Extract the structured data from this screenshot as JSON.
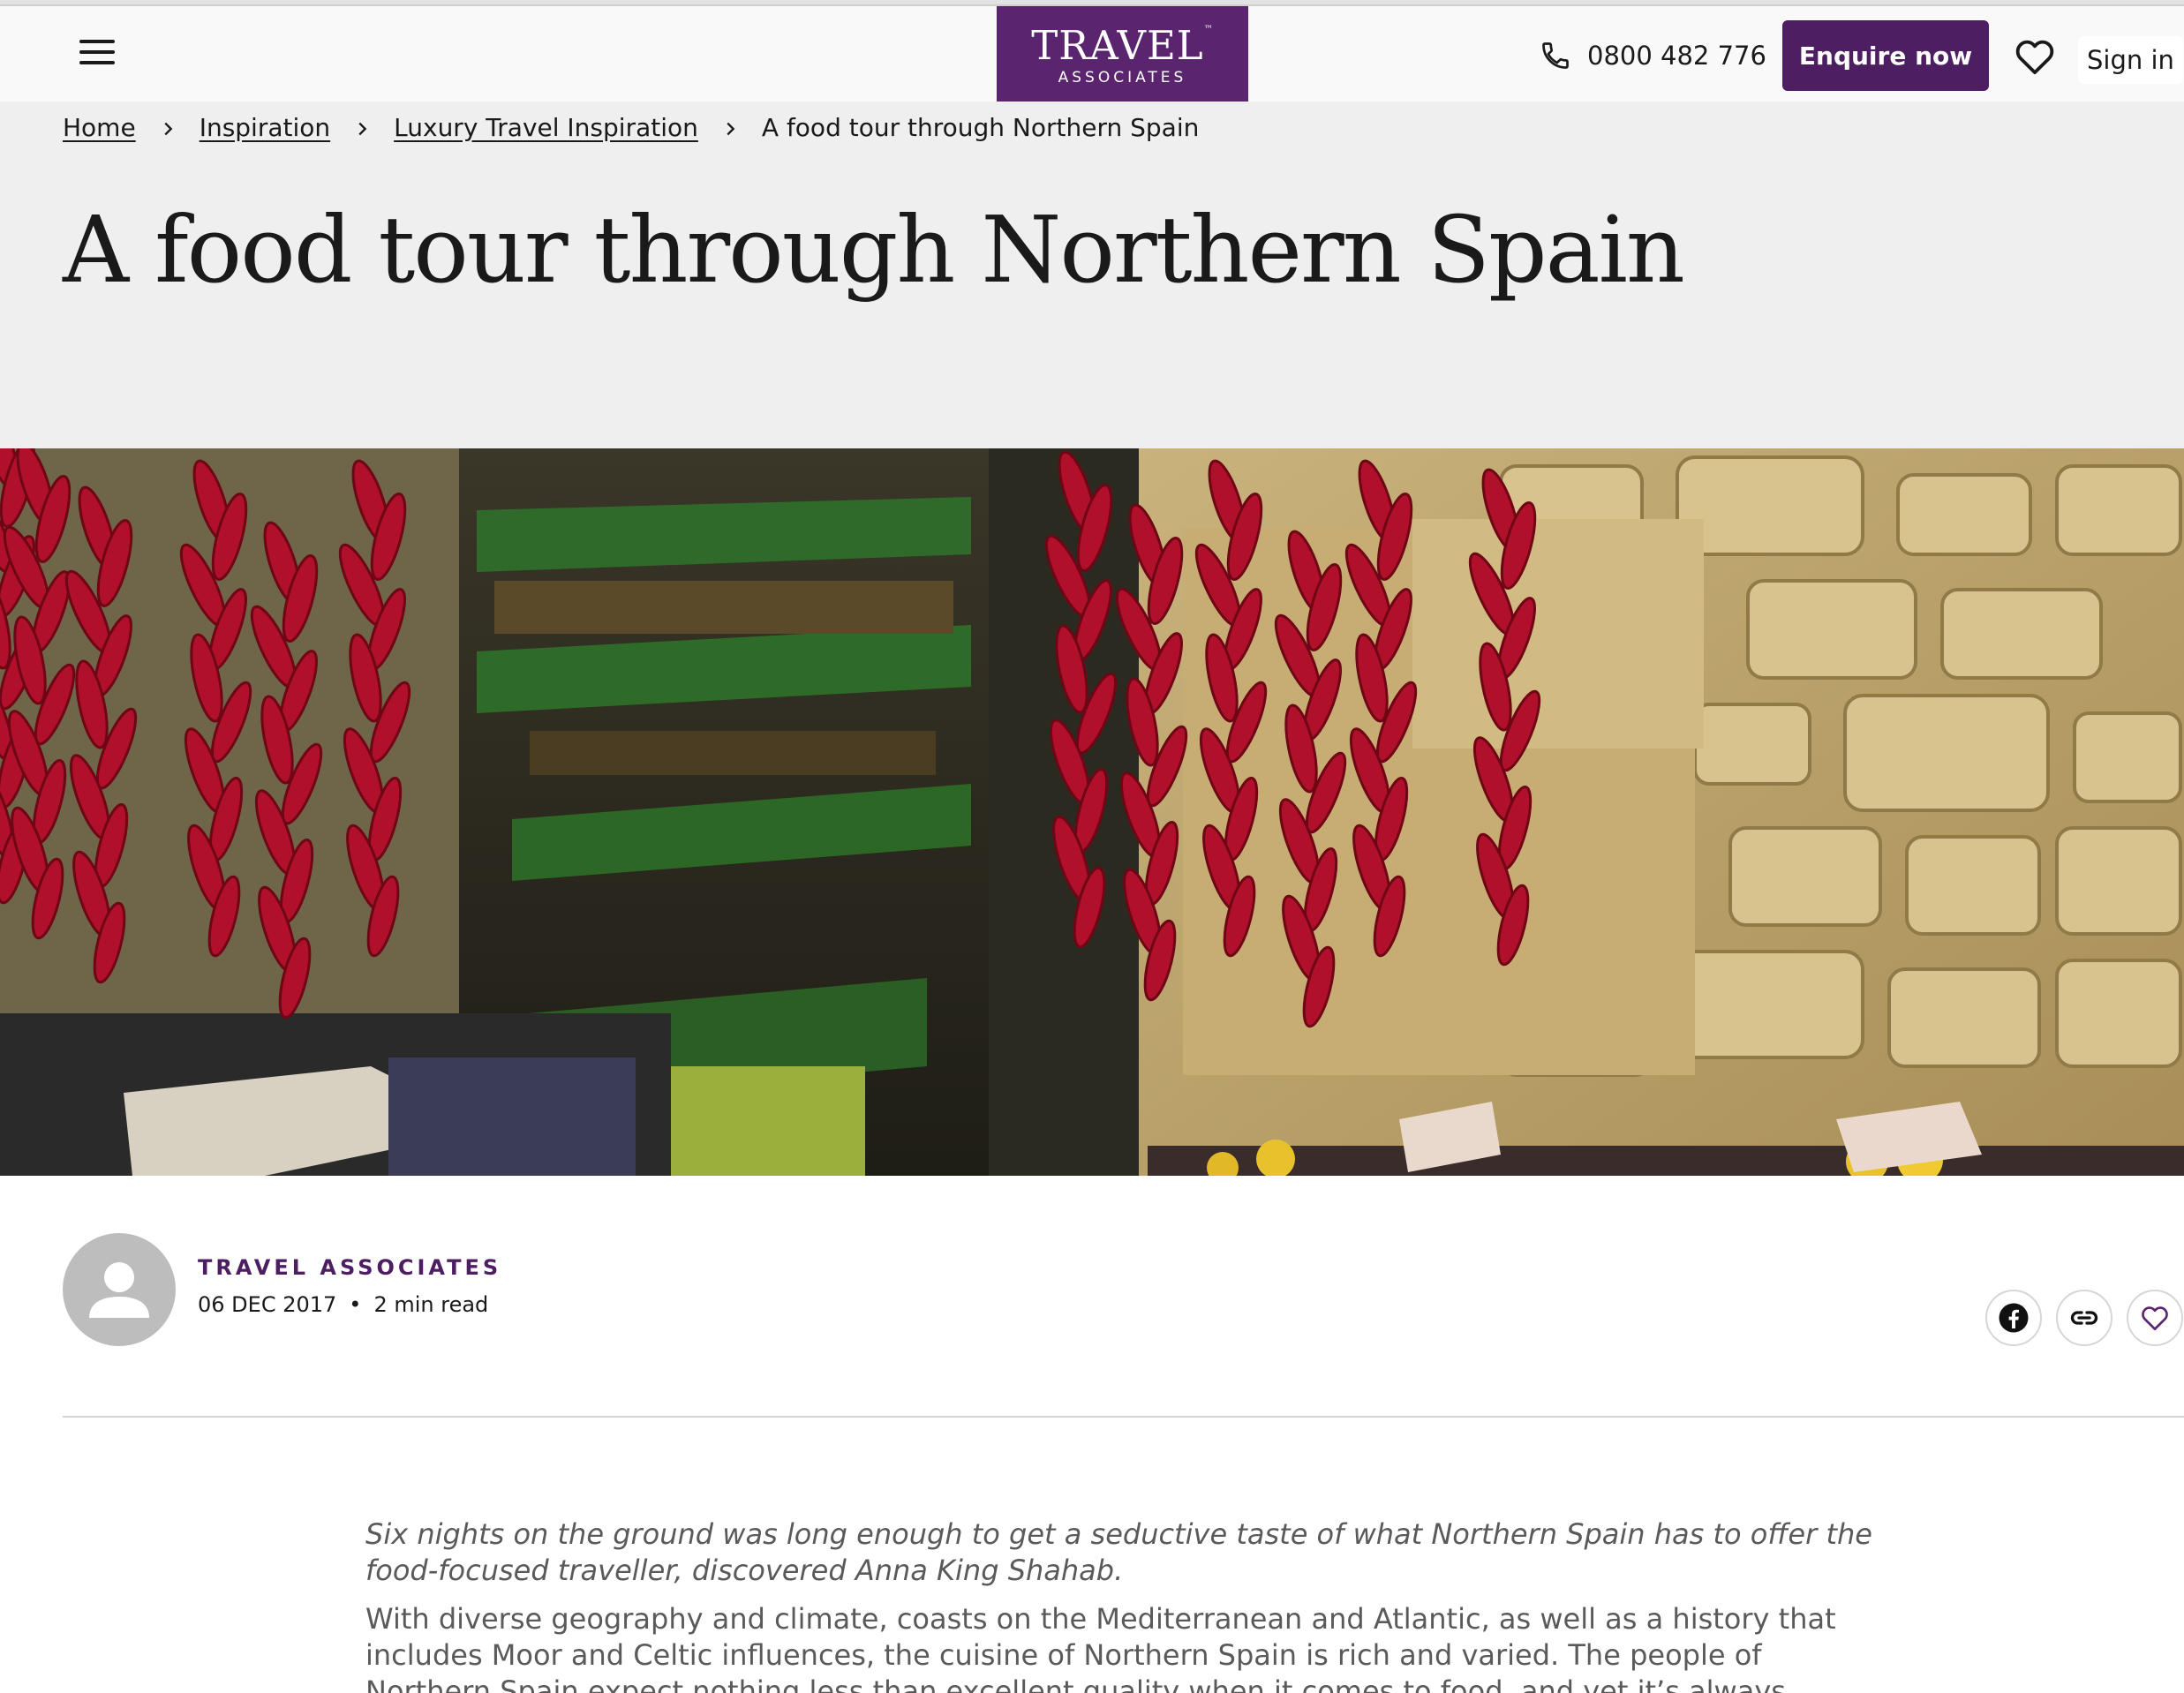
{
  "header": {
    "menu_icon": "hamburger-menu-icon",
    "logo_main": "TRAVEL",
    "logo_tm": "™",
    "logo_sub": "ASSOCIATES",
    "phone_icon": "phone-icon",
    "phone_number": "0800 482 776",
    "enquire_label": "Enquire now",
    "favourites_icon": "heart-icon",
    "signin_label": "Sign in",
    "brand_color": "#5a246e"
  },
  "breadcrumb": {
    "items": [
      "Home",
      "Inspiration",
      "Luxury Travel Inspiration"
    ],
    "current": "A food tour through Northern Spain",
    "separator_icon": "chevron-right-icon"
  },
  "article": {
    "title": "A food tour through Northern Spain",
    "hero_image": "market-stall-with-hanging-red-chilli-peppers-and-stone-wall",
    "author": "TRAVEL ASSOCIATES",
    "author_avatar_icon": "user-placeholder-icon",
    "date": "06 DEC 2017",
    "meta_separator": "•",
    "read_time": "2 min read",
    "share": {
      "facebook_icon": "facebook-icon",
      "link_icon": "link-icon",
      "save_icon": "heart-icon"
    },
    "lede": "Six nights on the ground was long enough to get a seductive taste of what Northern Spain has to offer the food-focused traveller, discovered Anna King Shahab.",
    "body": "With diverse geography and climate, coasts on the Mediterranean and Atlantic, as well as a history that includes Moor and Celtic influences, the cuisine of Northern Spain is rich and varied. The people of Northern Spain expect nothing less than excellent quality when it comes to food, and yet it’s always approachable and affordable. Best of"
  }
}
